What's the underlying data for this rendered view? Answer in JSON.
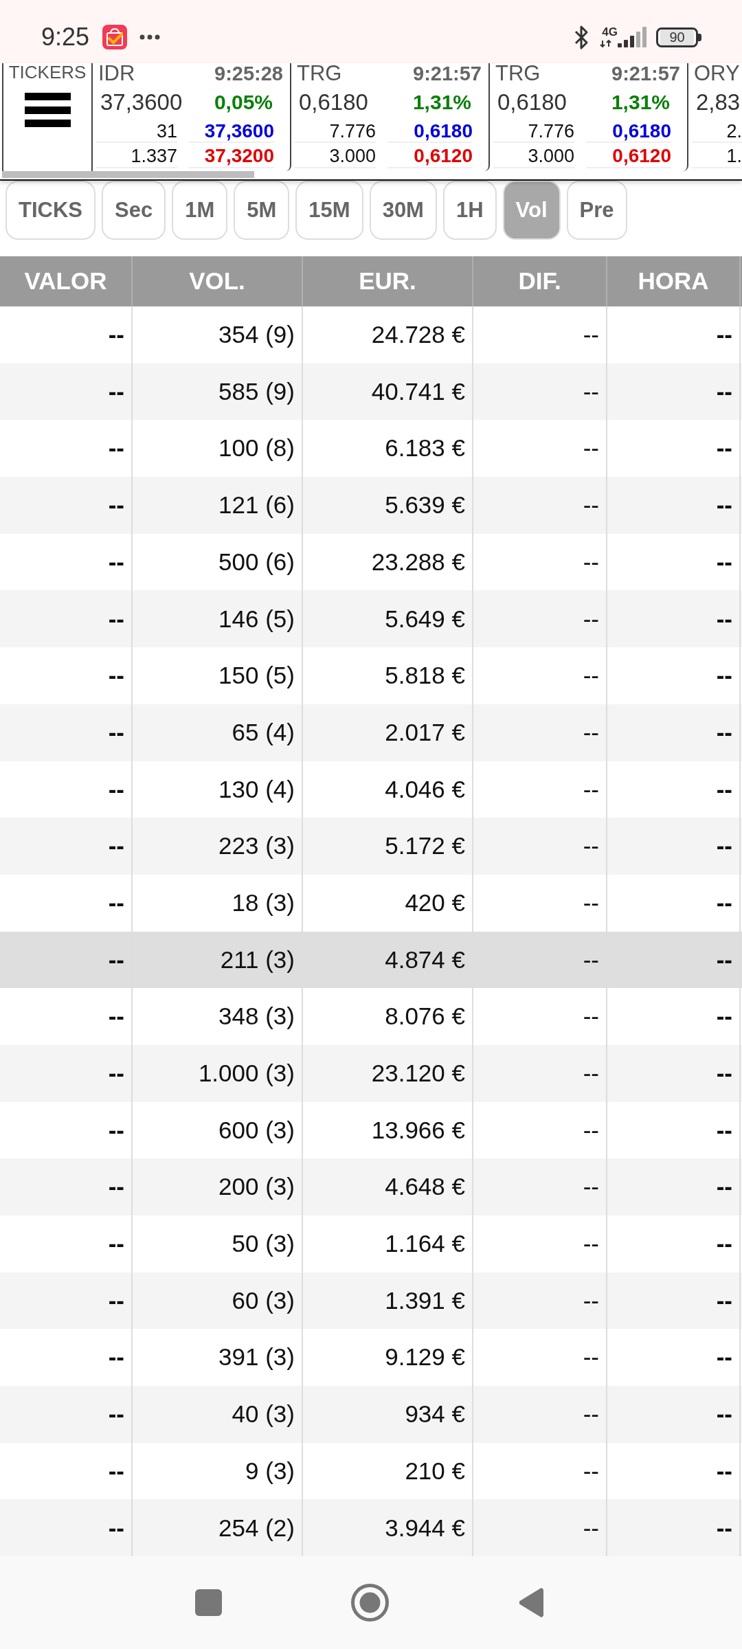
{
  "status_bar": {
    "time": "9:25",
    "network": "4G",
    "battery": "90"
  },
  "tickers": {
    "label": "TICKERS",
    "items": [
      {
        "symbol": "IDR",
        "time": "9:25:28",
        "price": "37,3600",
        "change": "0,05%",
        "bid_size": "31",
        "bid": "37,3600",
        "ask_size": "1.337",
        "ask": "37,3200"
      },
      {
        "symbol": "TRG",
        "time": "9:21:57",
        "price": "0,6180",
        "change": "1,31%",
        "bid_size": "7.776",
        "bid": "0,6180",
        "ask_size": "3.000",
        "ask": "0,6120"
      },
      {
        "symbol": "TRG",
        "time": "9:21:57",
        "price": "0,6180",
        "change": "1,31%",
        "bid_size": "7.776",
        "bid": "0,6180",
        "ask_size": "3.000",
        "ask": "0,6120"
      },
      {
        "symbol": "ORY",
        "price": "2,83",
        "bid_size": "2.",
        "ask_size": "1."
      }
    ]
  },
  "intervals": [
    {
      "label": "TICKS",
      "selected": false
    },
    {
      "label": "Sec",
      "selected": false
    },
    {
      "label": "1M",
      "selected": false
    },
    {
      "label": "5M",
      "selected": false
    },
    {
      "label": "15M",
      "selected": false
    },
    {
      "label": "30M",
      "selected": false
    },
    {
      "label": "1H",
      "selected": false
    },
    {
      "label": "Vol",
      "selected": true
    },
    {
      "label": "Pre",
      "selected": false
    }
  ],
  "table": {
    "columns": [
      "VALOR",
      "VOL.",
      "EUR.",
      "DIF.",
      "HORA"
    ],
    "rows": [
      {
        "cells": [
          "--",
          "354 (9)",
          "24.728 €",
          "--",
          "--"
        ],
        "selected": false
      },
      {
        "cells": [
          "--",
          "585 (9)",
          "40.741 €",
          "--",
          "--"
        ],
        "selected": false
      },
      {
        "cells": [
          "--",
          "100 (8)",
          "6.183 €",
          "--",
          "--"
        ],
        "selected": false
      },
      {
        "cells": [
          "--",
          "121 (6)",
          "5.639 €",
          "--",
          "--"
        ],
        "selected": false
      },
      {
        "cells": [
          "--",
          "500 (6)",
          "23.288 €",
          "--",
          "--"
        ],
        "selected": false
      },
      {
        "cells": [
          "--",
          "146 (5)",
          "5.649 €",
          "--",
          "--"
        ],
        "selected": false
      },
      {
        "cells": [
          "--",
          "150 (5)",
          "5.818 €",
          "--",
          "--"
        ],
        "selected": false
      },
      {
        "cells": [
          "--",
          "65 (4)",
          "2.017 €",
          "--",
          "--"
        ],
        "selected": false
      },
      {
        "cells": [
          "--",
          "130 (4)",
          "4.046 €",
          "--",
          "--"
        ],
        "selected": false
      },
      {
        "cells": [
          "--",
          "223 (3)",
          "5.172 €",
          "--",
          "--"
        ],
        "selected": false
      },
      {
        "cells": [
          "--",
          "18 (3)",
          "420 €",
          "--",
          "--"
        ],
        "selected": false
      },
      {
        "cells": [
          "--",
          "211 (3)",
          "4.874 €",
          "--",
          "--"
        ],
        "selected": true
      },
      {
        "cells": [
          "--",
          "348 (3)",
          "8.076 €",
          "--",
          "--"
        ],
        "selected": false
      },
      {
        "cells": [
          "--",
          "1.000 (3)",
          "23.120 €",
          "--",
          "--"
        ],
        "selected": false
      },
      {
        "cells": [
          "--",
          "600 (3)",
          "13.966 €",
          "--",
          "--"
        ],
        "selected": false
      },
      {
        "cells": [
          "--",
          "200 (3)",
          "4.648 €",
          "--",
          "--"
        ],
        "selected": false
      },
      {
        "cells": [
          "--",
          "50 (3)",
          "1.164 €",
          "--",
          "--"
        ],
        "selected": false
      },
      {
        "cells": [
          "--",
          "60 (3)",
          "1.391 €",
          "--",
          "--"
        ],
        "selected": false
      },
      {
        "cells": [
          "--",
          "391 (3)",
          "9.129 €",
          "--",
          "--"
        ],
        "selected": false
      },
      {
        "cells": [
          "--",
          "40 (3)",
          "934 €",
          "--",
          "--"
        ],
        "selected": false
      },
      {
        "cells": [
          "--",
          "9 (3)",
          "210 €",
          "--",
          "--"
        ],
        "selected": false
      },
      {
        "cells": [
          "--",
          "254 (2)",
          "3.944 €",
          "--",
          "--"
        ],
        "selected": false
      }
    ]
  }
}
